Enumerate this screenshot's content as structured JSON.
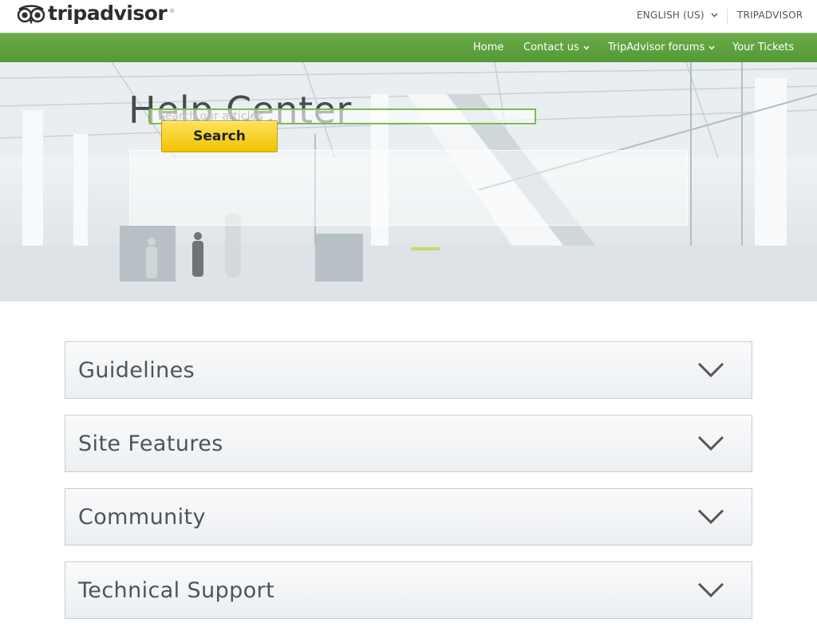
{
  "brand": {
    "name": "tripadvisor",
    "trademark": "®",
    "accent_color": "#589442"
  },
  "topbar": {
    "language": "ENGLISH (US)",
    "language_icon": "chevron-down-icon",
    "site_link": "TRIPADVISOR"
  },
  "nav": {
    "items": [
      {
        "label": "Home",
        "has_dropdown": false
      },
      {
        "label": "Contact us",
        "has_dropdown": true
      },
      {
        "label": "TripAdvisor forums",
        "has_dropdown": true
      },
      {
        "label": "Your Tickets",
        "has_dropdown": false
      }
    ],
    "color": "#5ea23c"
  },
  "hero": {
    "title": "Help Center",
    "search": {
      "placeholder": "Search our articles",
      "value": "",
      "button_label": "Search",
      "button_color": "#f7d21e",
      "input_border_color": "#7dbb4f"
    }
  },
  "sections": [
    {
      "label": "Guidelines",
      "icon": "chevron-down-icon"
    },
    {
      "label": "Site Features",
      "icon": "chevron-down-icon"
    },
    {
      "label": "Community",
      "icon": "chevron-down-icon"
    },
    {
      "label": "Technical Support",
      "icon": "chevron-down-icon"
    }
  ]
}
